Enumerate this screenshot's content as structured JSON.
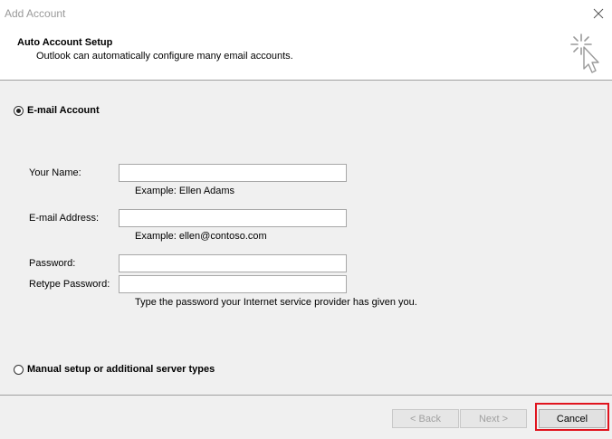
{
  "window": {
    "title": "Add Account"
  },
  "header": {
    "title": "Auto Account Setup",
    "subtitle": "Outlook can automatically configure many email accounts.",
    "icon": "cursor-click-icon"
  },
  "email_account": {
    "option_label": "E-mail Account",
    "selected": true,
    "your_name": {
      "label": "Your Name:",
      "value": "",
      "hint": "Example: Ellen Adams"
    },
    "email_address": {
      "label": "E-mail Address:",
      "value": "",
      "hint": "Example: ellen@contoso.com"
    },
    "password": {
      "label": "Password:",
      "value": ""
    },
    "retype_password": {
      "label": "Retype Password:",
      "value": "",
      "hint": "Type the password your Internet service provider has given you."
    }
  },
  "manual_setup": {
    "option_label": "Manual setup or additional server types",
    "selected": false
  },
  "footer": {
    "back_label": "< Back",
    "next_label": "Next >",
    "cancel_label": "Cancel"
  },
  "colors": {
    "highlight": "#e0141e",
    "panel_background": "#f0f0f0"
  }
}
